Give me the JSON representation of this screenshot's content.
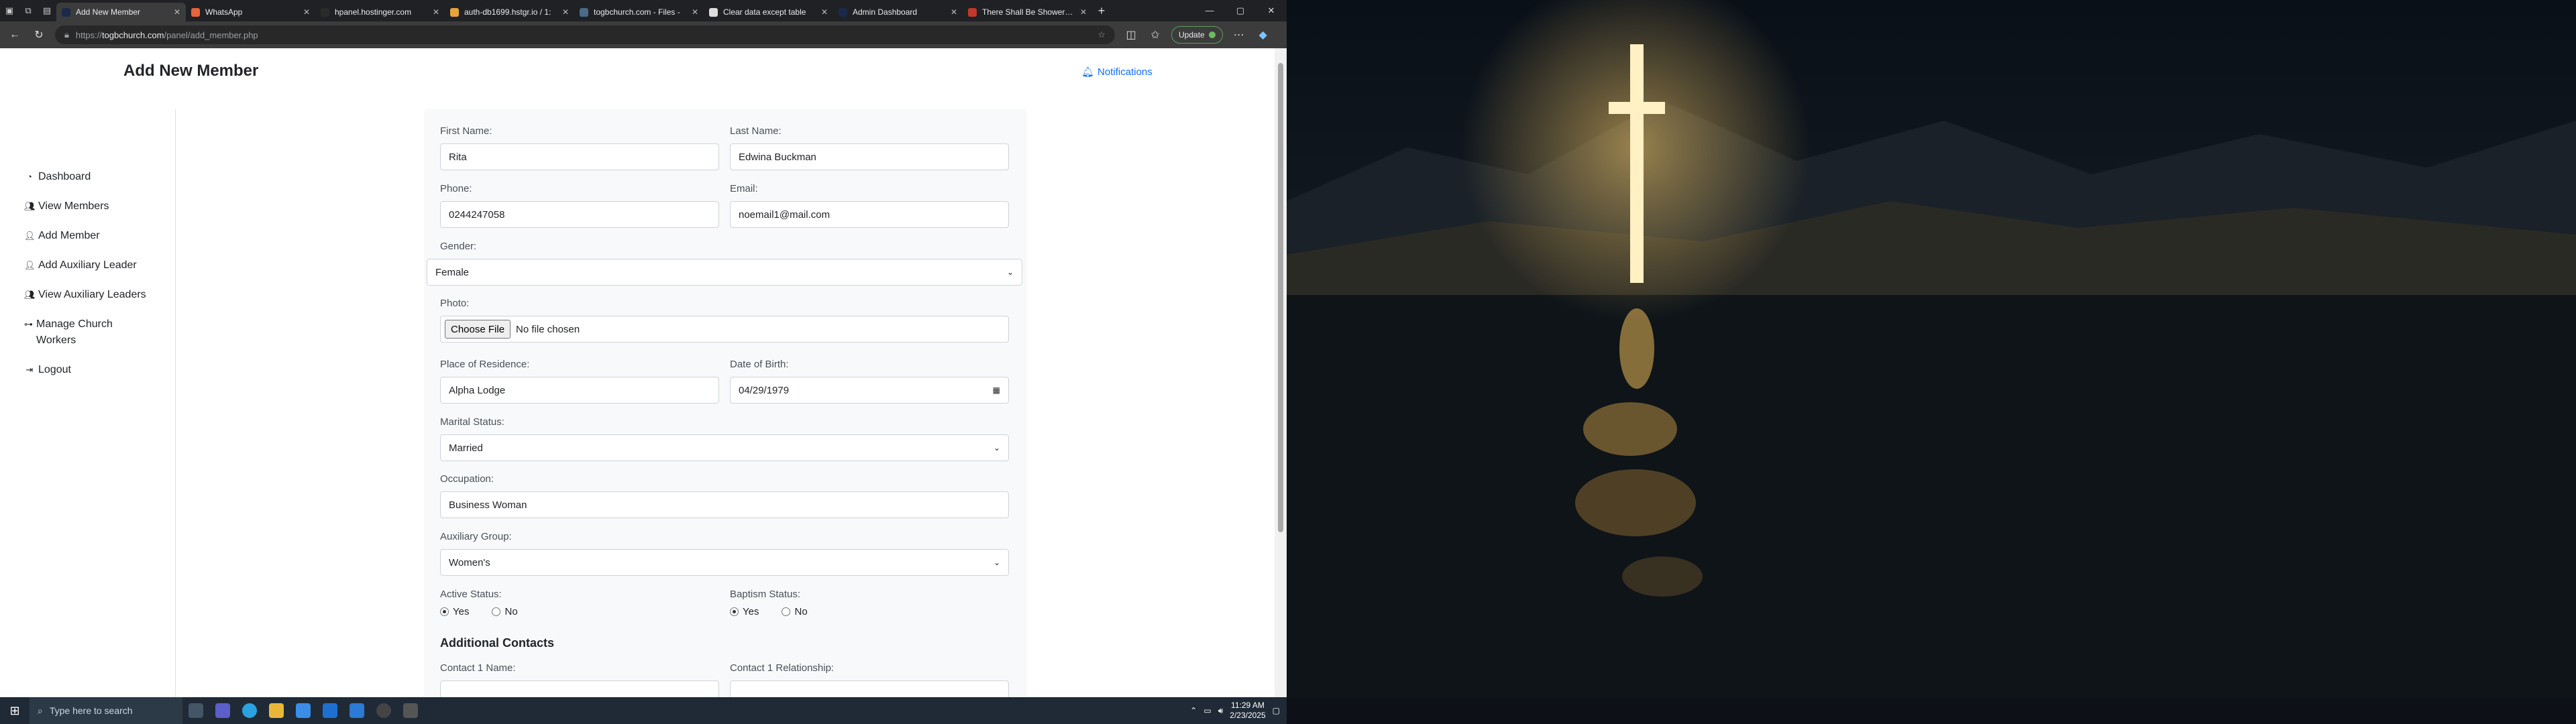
{
  "browser": {
    "tabs": [
      {
        "title": "Add New Member",
        "active": true,
        "color": "#1b2a4a"
      },
      {
        "title": "WhatsApp",
        "active": false,
        "color": "#e8643a"
      },
      {
        "title": "hpanel.hostinger.com",
        "active": false,
        "color": "#2b2b2b"
      },
      {
        "title": "auth-db1699.hstgr.io / 1:",
        "active": false,
        "color": "#e8a33a"
      },
      {
        "title": "togbchurch.com - Files -",
        "active": false,
        "color": "#4a6a8a"
      },
      {
        "title": "Clear data except table",
        "active": false,
        "color": "#dddddd"
      },
      {
        "title": "Admin Dashboard",
        "active": false,
        "color": "#1b2a4a"
      },
      {
        "title": "There Shall Be Showers o",
        "active": false,
        "color": "#c0392b"
      }
    ],
    "url_prefix": "https://",
    "url_host": "togbchurch.com",
    "url_path": "/panel/add_member.php",
    "update_label": "Update"
  },
  "page": {
    "title": "Add New Member",
    "notifications_label": "Notifications"
  },
  "sidebar": {
    "items": [
      {
        "label": "Dashboard",
        "icon": "tachometer-icon"
      },
      {
        "label": "View Members",
        "icon": "users-icon"
      },
      {
        "label": "Add Member",
        "icon": "user-plus-icon"
      },
      {
        "label": "Add Auxiliary Leader",
        "icon": "user-icon"
      },
      {
        "label": "View Auxiliary Leaders",
        "icon": "users-icon"
      },
      {
        "label": "Manage Church Workers",
        "icon": "sitemap-icon"
      },
      {
        "label": "Logout",
        "icon": "logout-icon"
      }
    ]
  },
  "form": {
    "first_name": {
      "label": "First Name:",
      "value": "Rita"
    },
    "last_name": {
      "label": "Last Name:",
      "value": "Edwina Buckman"
    },
    "phone": {
      "label": "Phone:",
      "value": "0244247058"
    },
    "email": {
      "label": "Email:",
      "value": "noemail1@mail.com"
    },
    "gender": {
      "label": "Gender:",
      "value": "Female"
    },
    "photo": {
      "label": "Photo:",
      "button": "Choose File",
      "status": "No file chosen"
    },
    "residence": {
      "label": "Place of Residence:",
      "value": "Alpha Lodge"
    },
    "dob": {
      "label": "Date of Birth:",
      "value": "04/29/1979"
    },
    "marital": {
      "label": "Marital Status:",
      "value": "Married"
    },
    "occupation": {
      "label": "Occupation:",
      "value": "Business Woman"
    },
    "auxiliary": {
      "label": "Auxiliary Group:",
      "value": "Women's"
    },
    "active": {
      "label": "Active Status:",
      "yes": "Yes",
      "no": "No",
      "selected": "yes"
    },
    "baptism": {
      "label": "Baptism Status:",
      "yes": "Yes",
      "no": "No",
      "selected": "yes"
    },
    "additional_title": "Additional Contacts",
    "contact1_name": {
      "label": "Contact 1 Name:"
    },
    "contact1_relationship": {
      "label": "Contact 1 Relationship:"
    }
  },
  "taskbar": {
    "search_placeholder": "Type here to search",
    "time": "11:29 AM",
    "date": "2/23/2025"
  }
}
